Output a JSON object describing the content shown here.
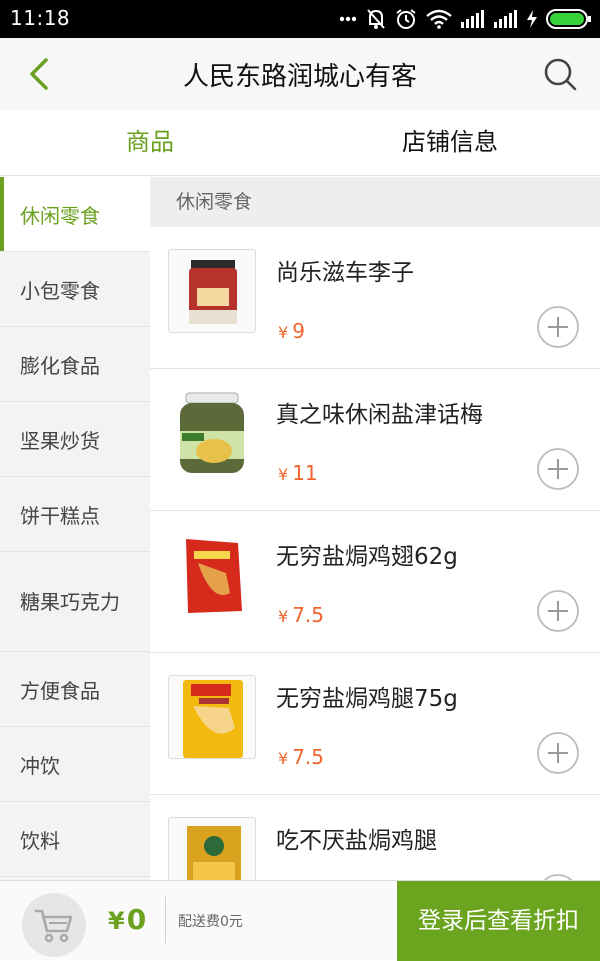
{
  "status_bar": {
    "time": "11:18",
    "icons": [
      "more-icon",
      "mute-icon",
      "alarm-icon",
      "wifi-icon",
      "signal-icon",
      "signal-icon",
      "charging-icon",
      "battery-icon"
    ]
  },
  "header": {
    "title": "人民东路润城心有客",
    "back_icon": "chevron-left-icon",
    "search_icon": "search-icon"
  },
  "tabs": [
    {
      "label": "商品",
      "active": true
    },
    {
      "label": "店铺信息",
      "active": false
    }
  ],
  "sidebar": {
    "items": [
      {
        "label": "休闲零食"
      },
      {
        "label": "小包零食"
      },
      {
        "label": "膨化食品"
      },
      {
        "label": "坚果炒货"
      },
      {
        "label": "饼干糕点"
      },
      {
        "label": "糖果巧克力"
      },
      {
        "label": "方便食品"
      },
      {
        "label": "冲饮"
      },
      {
        "label": "饮料"
      }
    ]
  },
  "content": {
    "section_title": "休闲零食",
    "products": [
      {
        "name": "尚乐滋车李子",
        "currency": "¥",
        "price": "9"
      },
      {
        "name": "真之味休闲盐津话梅",
        "currency": "¥",
        "price": "11"
      },
      {
        "name": "无穷盐焗鸡翅62g",
        "currency": "¥",
        "price": "7.5"
      },
      {
        "name": "无穷盐焗鸡腿75g",
        "currency": "¥",
        "price": "7.5"
      },
      {
        "name": "吃不厌盐焗鸡腿",
        "currency": "¥",
        "price": ""
      }
    ]
  },
  "bottom_bar": {
    "cart_icon": "cart-icon",
    "currency": "¥",
    "total": "0",
    "delivery_fee": "配送费0元",
    "login_button": "登录后查看折扣"
  },
  "colors": {
    "accent": "#6aa11e",
    "price": "#f0642e",
    "button": "#6ba51f"
  }
}
